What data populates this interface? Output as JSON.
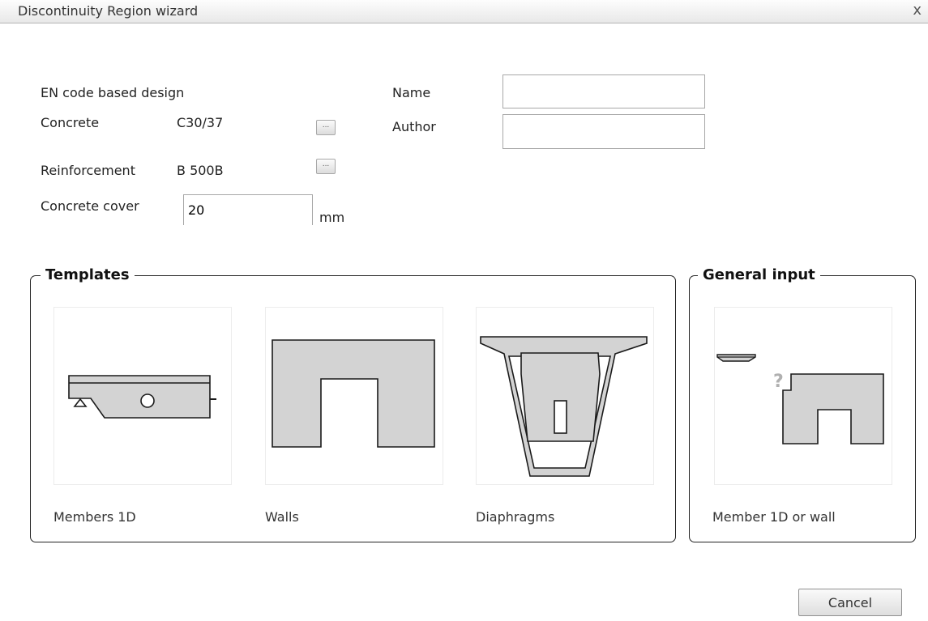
{
  "window": {
    "title": "Discontinuity Region wizard",
    "close_glyph": "x"
  },
  "form": {
    "design_code": "EN code based design",
    "concrete_label": "Concrete",
    "concrete_value": "C30/37",
    "reinforcement_label": "Reinforcement",
    "reinforcement_value": "B 500B",
    "cover_label": "Concrete cover",
    "cover_value": "20",
    "cover_unit": "mm",
    "browse_glyph": "...",
    "name_label": "Name",
    "name_value": "",
    "author_label": "Author",
    "author_value": ""
  },
  "templates": {
    "title": "Templates",
    "items": [
      {
        "label": "Members 1D",
        "icon": "member-1d-icon"
      },
      {
        "label": "Walls",
        "icon": "wall-icon"
      },
      {
        "label": "Diaphragms",
        "icon": "diaphragm-icon"
      }
    ]
  },
  "general_input": {
    "title": "General input",
    "items": [
      {
        "label": "Member 1D or wall",
        "icon": "member-or-wall-icon"
      }
    ]
  },
  "footer": {
    "cancel_label": "Cancel"
  },
  "colors": {
    "shape_fill": "#d3d3d3",
    "shape_stroke": "#1a1a1a",
    "question_mark": "#b0b0b0"
  }
}
